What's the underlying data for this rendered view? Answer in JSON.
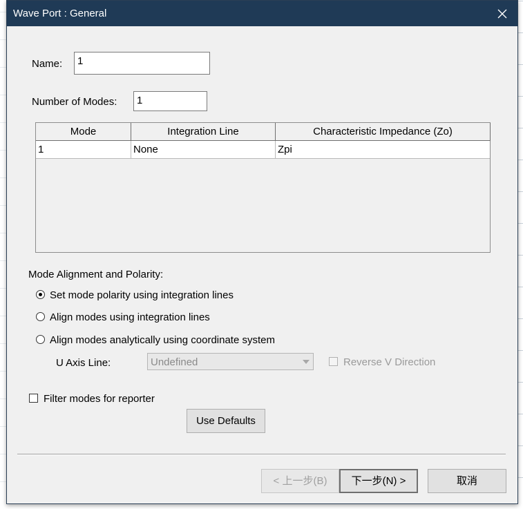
{
  "window": {
    "title": "Wave Port : General",
    "close_icon": "close-icon"
  },
  "form": {
    "name_label": "Name:",
    "name_value": "1",
    "modes_label": "Number of Modes:",
    "modes_value": "1"
  },
  "table": {
    "columns": [
      "Mode",
      "Integration Line",
      "Characteristic Impedance (Zo)"
    ],
    "rows": [
      [
        "1",
        "None",
        "Zpi"
      ]
    ]
  },
  "alignment": {
    "section_label": "Mode Alignment and Polarity:",
    "options": [
      {
        "label": "Set mode polarity using integration lines",
        "checked": true
      },
      {
        "label": "Align modes using integration lines",
        "checked": false
      },
      {
        "label": "Align modes analytically using coordinate system",
        "checked": false
      }
    ],
    "u_axis_label": "U Axis Line:",
    "u_axis_value": "Undefined",
    "reverse_v_label": "Reverse V Direction"
  },
  "filter": {
    "label": "Filter modes for reporter",
    "checked": false
  },
  "buttons": {
    "use_defaults": "Use Defaults",
    "back": "< 上一步(B)",
    "next": "下一步(N) >",
    "cancel": "取消"
  }
}
